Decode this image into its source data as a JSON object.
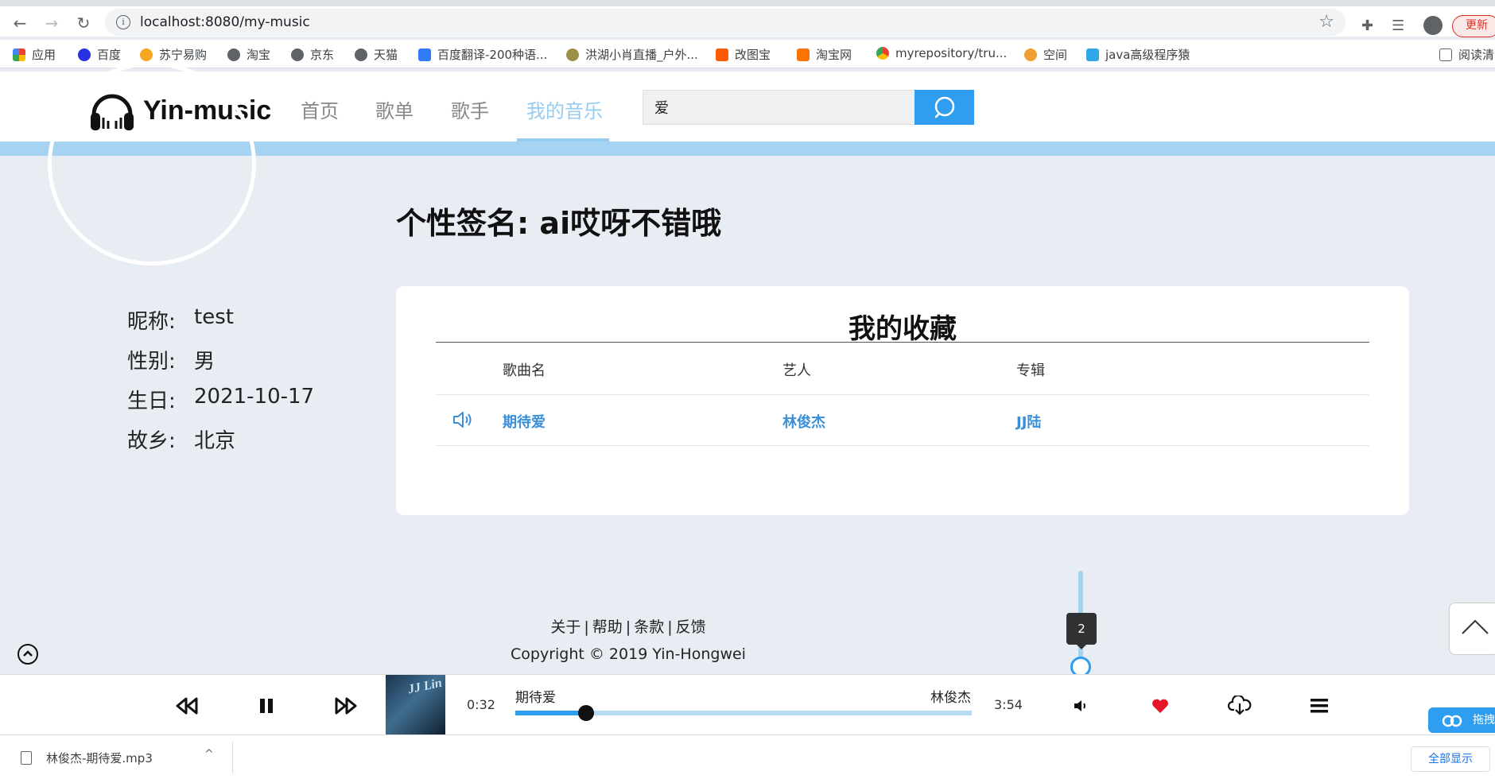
{
  "browser": {
    "url": "localhost:8080/my-music",
    "update_label": "更新",
    "bookmarks": [
      "应用",
      "百度",
      "苏宁易购",
      "淘宝",
      "京东",
      "天猫",
      "百度翻译-200种语...",
      "洪湖小肖直播_户外...",
      "改图宝",
      "淘宝网",
      "myrepository/tru...",
      "空间",
      "java高级程序猿"
    ],
    "reading_list": "阅读清"
  },
  "header": {
    "logo": "Yin-music",
    "nav": [
      "首页",
      "歌单",
      "歌手",
      "我的音乐"
    ],
    "active_nav": "我的音乐",
    "search_value": "爱"
  },
  "profile": {
    "signature": "个性签名: ai哎呀不错哦",
    "fields": [
      {
        "key": "昵称:",
        "value": "test"
      },
      {
        "key": "性别:",
        "value": "男"
      },
      {
        "key": "生日:",
        "value": "2021-10-17"
      },
      {
        "key": "故乡:",
        "value": "北京"
      }
    ]
  },
  "favorites": {
    "title": "我的收藏",
    "columns": [
      "歌曲名",
      "艺人",
      "专辑"
    ],
    "rows": [
      {
        "song": "期待爱",
        "artist": "林俊杰",
        "album": "JJ陆"
      }
    ]
  },
  "footer": {
    "links": [
      "关于",
      "帮助",
      "条款",
      "反馈"
    ],
    "separator": "|",
    "copyright": "Copyright © 2019 Yin-Hongwei"
  },
  "player": {
    "current_time": "0:32",
    "total_time": "3:54",
    "song": "期待爱",
    "artist": "林俊杰",
    "progress_fraction": 0.155,
    "volume_tooltip": "2",
    "cover_text": "JJ Lin"
  },
  "downloads": {
    "file": "林俊杰-期待爱.mp3",
    "show_all": "全部显示",
    "side_ext": "拖拽"
  },
  "colors": {
    "accent": "#2f9ef0",
    "nav_active": "#95ccef",
    "link": "#3a8fd8",
    "heart": "#e8152a"
  }
}
